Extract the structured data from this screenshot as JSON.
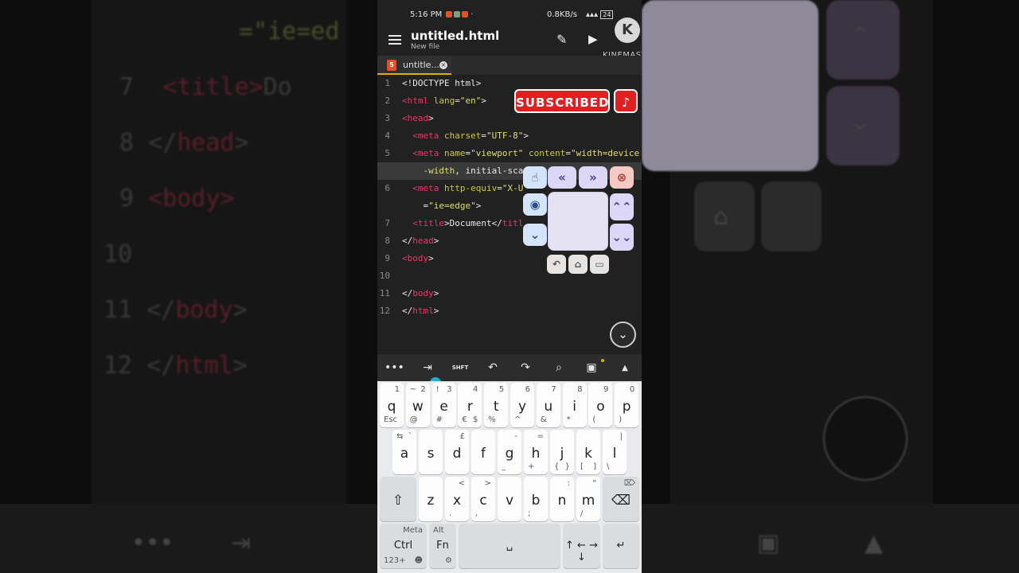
{
  "status_bar": {
    "time": "5:16 PM",
    "net": "0.8KB/s",
    "battery": "24"
  },
  "app_bar": {
    "title": "untitled.html",
    "subtitle": "New file"
  },
  "watermark": {
    "logo": "K",
    "text": "KINEMASTER"
  },
  "tab": {
    "icon": "5",
    "label": "untitle...",
    "close": "×"
  },
  "editor": {
    "lines": [
      {
        "n": "1",
        "parts": [
          [
            "p",
            "<!DOCTYPE html>"
          ]
        ]
      },
      {
        "n": "2",
        "parts": [
          [
            "t",
            "<html"
          ],
          [
            "a",
            " lang"
          ],
          [
            "p",
            "="
          ],
          [
            "s",
            "\"en\""
          ],
          [
            "p",
            ">"
          ]
        ]
      },
      {
        "n": "3",
        "parts": [
          [
            "t",
            "<head"
          ],
          [
            "p",
            ">"
          ]
        ]
      },
      {
        "n": "4",
        "parts": [
          [
            "p",
            "  "
          ],
          [
            "t",
            "<meta"
          ],
          [
            "a",
            " charset"
          ],
          [
            "p",
            "="
          ],
          [
            "s",
            "\"UTF-8\""
          ],
          [
            "p",
            ">"
          ]
        ]
      },
      {
        "n": "5",
        "parts": [
          [
            "p",
            "  "
          ],
          [
            "t",
            "<meta"
          ],
          [
            "a",
            " name"
          ],
          [
            "p",
            "="
          ],
          [
            "s",
            "\"viewport\""
          ],
          [
            "a",
            " content"
          ],
          [
            "p",
            "="
          ],
          [
            "s",
            "\"width=device"
          ]
        ]
      },
      {
        "n": "",
        "parts": [
          [
            "s",
            "    -width"
          ],
          [
            "p",
            ", initial-sca"
          ]
        ]
      },
      {
        "n": "6",
        "parts": [
          [
            "p",
            "  "
          ],
          [
            "t",
            "<meta"
          ],
          [
            "a",
            " http-equiv"
          ],
          [
            "p",
            "="
          ],
          [
            "s",
            "\"X-U"
          ]
        ]
      },
      {
        "n": "",
        "parts": [
          [
            "p",
            "    "
          ],
          [
            "p",
            "="
          ],
          [
            "s",
            "\"ie=edge\""
          ],
          [
            "p",
            ">"
          ]
        ]
      },
      {
        "n": "7",
        "parts": [
          [
            "p",
            "  "
          ],
          [
            "t",
            "<title"
          ],
          [
            "p",
            ">Document</"
          ],
          [
            "t",
            "titl"
          ]
        ]
      },
      {
        "n": "8",
        "parts": [
          [
            "p",
            "</"
          ],
          [
            "t",
            "head"
          ],
          [
            "p",
            ">"
          ]
        ]
      },
      {
        "n": "9",
        "parts": [
          [
            "t",
            "<body"
          ],
          [
            "p",
            ">"
          ]
        ]
      },
      {
        "n": "10",
        "parts": []
      },
      {
        "n": "11",
        "parts": [
          [
            "p",
            "</"
          ],
          [
            "t",
            "body"
          ],
          [
            "p",
            ">"
          ]
        ]
      },
      {
        "n": "12",
        "parts": [
          [
            "p",
            "</"
          ],
          [
            "t",
            "html"
          ],
          [
            "p",
            ">"
          ]
        ]
      }
    ]
  },
  "overlay": {
    "subscribe": "SUBSCRIBED",
    "bell": "🔔"
  },
  "float_panel": {
    "hand": "☝",
    "rewind": "«",
    "forward": "»",
    "close": "⊗",
    "record": "◉",
    "up": "⌃⌃",
    "down_left": "⌄",
    "down": "⌄⌄",
    "back": "↶",
    "home": "⌂",
    "recent": "▭"
  },
  "scroll_fab": "⌄",
  "toolbar": {
    "more": "•••",
    "tab": "⇥",
    "shift": "SHFT",
    "undo": "↶",
    "redo": "↷",
    "search": "⌕",
    "save": "▣",
    "expand": "▲"
  },
  "keyboard": {
    "row1": [
      {
        "m": "q",
        "tl": "",
        "tr": "1",
        "bl": "Esc",
        "br": ""
      },
      {
        "m": "w",
        "tl": "~",
        "tr": "2",
        "bl": "@",
        "br": ""
      },
      {
        "m": "e",
        "tl": "!",
        "tr": "3",
        "bl": "#",
        "br": ""
      },
      {
        "m": "r",
        "tl": "",
        "tr": "4",
        "bl": "€",
        "br": "$"
      },
      {
        "m": "t",
        "tl": "",
        "tr": "5",
        "bl": "%",
        "br": ""
      },
      {
        "m": "y",
        "tl": "",
        "tr": "6",
        "bl": "^",
        "br": ""
      },
      {
        "m": "u",
        "tl": "",
        "tr": "7",
        "bl": "&",
        "br": ""
      },
      {
        "m": "i",
        "tl": "",
        "tr": "8",
        "bl": "*",
        "br": ""
      },
      {
        "m": "o",
        "tl": "",
        "tr": "9",
        "bl": "(",
        "br": ""
      },
      {
        "m": "p",
        "tl": "",
        "tr": "0",
        "bl": ")",
        "br": ""
      }
    ],
    "row2": [
      {
        "m": "a",
        "tl": "⇆",
        "tr": "`",
        "bl": "",
        "br": ""
      },
      {
        "m": "s",
        "tl": "",
        "tr": "",
        "bl": "",
        "br": ""
      },
      {
        "m": "d",
        "tl": "",
        "tr": "£",
        "bl": "",
        "br": ""
      },
      {
        "m": "f",
        "tl": "",
        "tr": "",
        "bl": "",
        "br": ""
      },
      {
        "m": "g",
        "tl": "",
        "tr": "-",
        "bl": "_",
        "br": ""
      },
      {
        "m": "h",
        "tl": "",
        "tr": "=",
        "bl": "+",
        "br": ""
      },
      {
        "m": "j",
        "tl": "",
        "tr": "",
        "bl": "{",
        "br": "}"
      },
      {
        "m": "k",
        "tl": "",
        "tr": "",
        "bl": "[",
        "br": "]"
      },
      {
        "m": "l",
        "tl": "",
        "tr": "|",
        "bl": "\\",
        "br": ""
      }
    ],
    "row3": [
      {
        "m": "⇧",
        "tl": "",
        "tr": "",
        "bl": "",
        "br": ""
      },
      {
        "m": "z",
        "tl": "",
        "tr": "",
        "bl": "",
        "br": ""
      },
      {
        "m": "x",
        "tl": "",
        "tr": "<",
        "bl": ".",
        "br": ""
      },
      {
        "m": "c",
        "tl": "",
        "tr": ">",
        "bl": ",",
        "br": ""
      },
      {
        "m": "v",
        "tl": "",
        "tr": "",
        "bl": "",
        "br": ""
      },
      {
        "m": "b",
        "tl": "",
        "tr": "",
        "bl": ";",
        "br": ""
      },
      {
        "m": "n",
        "tl": "",
        "tr": ":",
        "bl": "",
        "br": ""
      },
      {
        "m": "m",
        "tl": "",
        "tr": "\"",
        "bl": "/",
        "br": ""
      },
      {
        "m": "⌫",
        "tl": "",
        "tr": "⌦",
        "bl": "",
        "br": ""
      }
    ],
    "row4": {
      "ctrl": "Ctrl",
      "meta": "Meta",
      "alt": "Alt",
      "fn": "Fn",
      "num": "123+",
      "emoji": "☻",
      "gear": "⚙",
      "space": "␣",
      "arrows": "↑ ← → ↓",
      "enter": "↵"
    }
  }
}
